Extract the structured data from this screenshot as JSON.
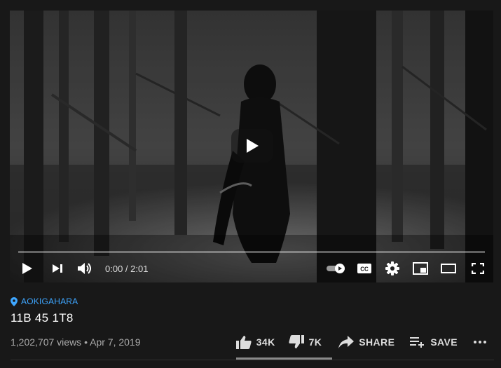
{
  "player": {
    "current_time": "0:00",
    "separator": " / ",
    "duration": "2:01",
    "progress": 0.0
  },
  "video": {
    "location": "AOKIGAHARA",
    "title": "11B 45 1T8",
    "views": "1,202,707 views",
    "date_sep": "•",
    "date": "Apr 7, 2019"
  },
  "actions": {
    "like_count": "34K",
    "dislike_count": "7K",
    "share_label": "SHARE",
    "save_label": "SAVE"
  },
  "colors": {
    "background": "#181818",
    "link": "#3ea6ff",
    "secondary_text": "#aaa"
  },
  "icons": [
    "play-icon",
    "next-icon",
    "volume-icon",
    "autoplay-toggle-icon",
    "captions-icon",
    "settings-icon",
    "miniplayer-icon",
    "theater-icon",
    "fullscreen-icon",
    "location-pin-icon",
    "thumb-up-icon",
    "thumb-down-icon",
    "share-icon",
    "save-playlist-icon",
    "more-icon"
  ]
}
